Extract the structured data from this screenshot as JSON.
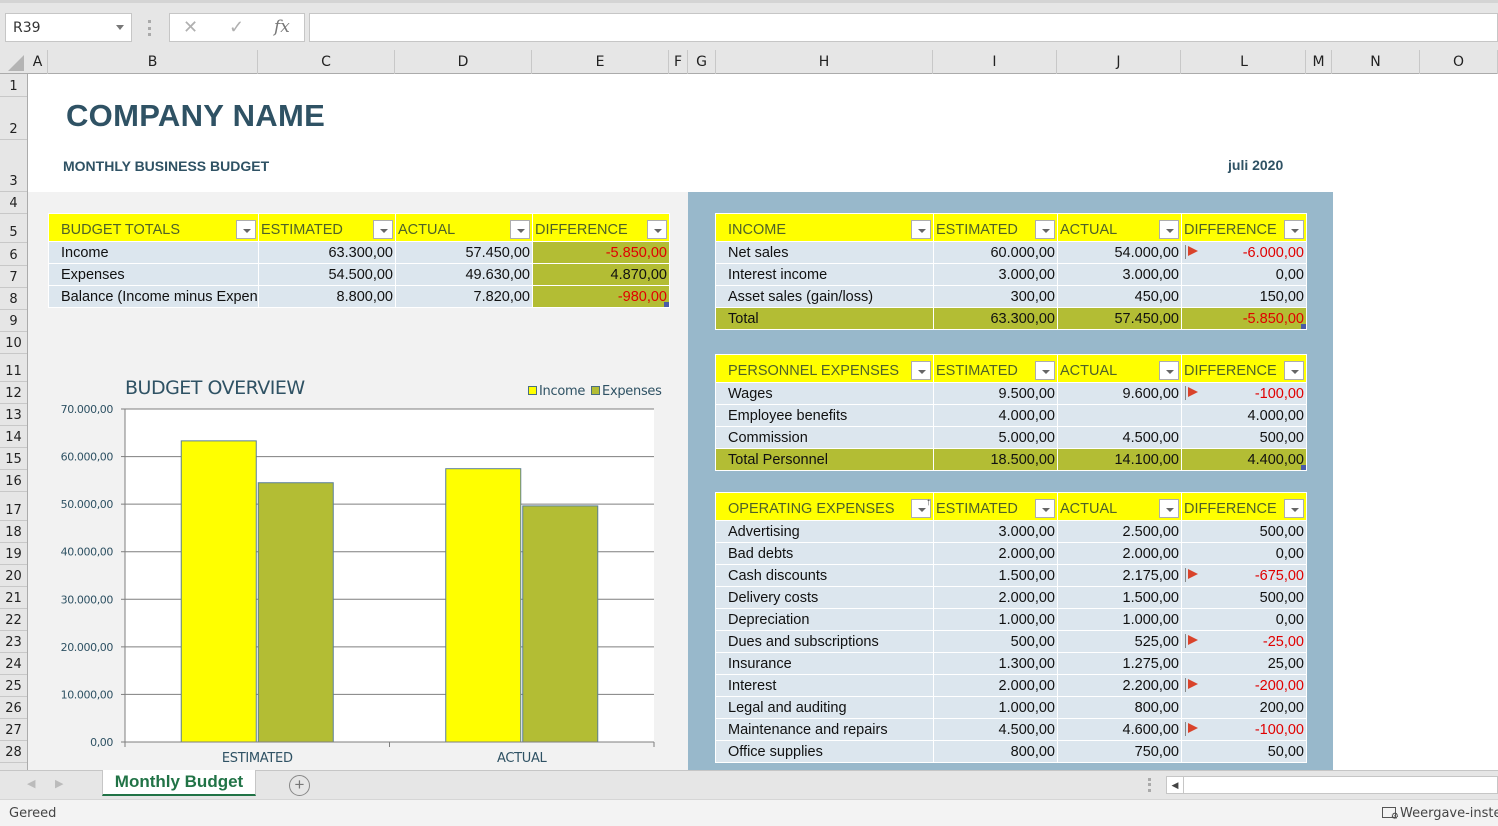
{
  "formula_bar": {
    "name_box": "R39",
    "cancel_icon": "✕",
    "enter_icon": "✓",
    "fx_label": "fx",
    "formula": ""
  },
  "columns": [
    "A",
    "B",
    "C",
    "D",
    "E",
    "F",
    "G",
    "H",
    "I",
    "J",
    "L",
    "M",
    "N",
    "O"
  ],
  "rows": [
    "1",
    "2",
    "3",
    "4",
    "5",
    "6",
    "7",
    "8",
    "9",
    "10",
    "11",
    "12",
    "13",
    "14",
    "15",
    "16",
    "17",
    "18",
    "19",
    "20",
    "21",
    "22",
    "23",
    "24",
    "25",
    "26",
    "27",
    "28"
  ],
  "sheet": {
    "company_name": "COMPANY NAME",
    "subtitle": "MONTHLY BUSINESS BUDGET",
    "month": "juli 2020"
  },
  "budget_totals": {
    "headers": [
      "BUDGET TOTALS",
      "ESTIMATED",
      "ACTUAL",
      "DIFFERENCE"
    ],
    "rows": [
      {
        "label": "Income",
        "estimated": "63.300,00",
        "actual": "57.450,00",
        "difference": "-5.850,00",
        "negative": true
      },
      {
        "label": "Expenses",
        "estimated": "54.500,00",
        "actual": "49.630,00",
        "difference": "4.870,00",
        "negative": false
      },
      {
        "label": "Balance (Income minus Expenses)",
        "estimated": "8.800,00",
        "actual": "7.820,00",
        "difference": "-980,00",
        "negative": true
      }
    ]
  },
  "income": {
    "headers": [
      "INCOME",
      "ESTIMATED",
      "ACTUAL",
      "DIFFERENCE"
    ],
    "rows": [
      {
        "label": "Net sales",
        "estimated": "60.000,00",
        "actual": "54.000,00",
        "difference": "-6.000,00",
        "negative": true,
        "flag": true
      },
      {
        "label": "Interest income",
        "estimated": "3.000,00",
        "actual": "3.000,00",
        "difference": "0,00",
        "negative": false,
        "flag": false
      },
      {
        "label": "Asset sales (gain/loss)",
        "estimated": "300,00",
        "actual": "450,00",
        "difference": "150,00",
        "negative": false,
        "flag": false
      }
    ],
    "total": {
      "label": "Total",
      "estimated": "63.300,00",
      "actual": "57.450,00",
      "difference": "-5.850,00",
      "negative": true
    }
  },
  "personnel": {
    "headers": [
      "PERSONNEL EXPENSES",
      "ESTIMATED",
      "ACTUAL",
      "DIFFERENCE"
    ],
    "rows": [
      {
        "label": "Wages",
        "estimated": "9.500,00",
        "actual": "9.600,00",
        "difference": "-100,00",
        "negative": true,
        "flag": true
      },
      {
        "label": "Employee benefits",
        "estimated": "4.000,00",
        "actual": "",
        "difference": "4.000,00",
        "negative": false,
        "flag": false
      },
      {
        "label": "Commission",
        "estimated": "5.000,00",
        "actual": "4.500,00",
        "difference": "500,00",
        "negative": false,
        "flag": false
      }
    ],
    "total": {
      "label": "Total Personnel",
      "estimated": "18.500,00",
      "actual": "14.100,00",
      "difference": "4.400,00",
      "negative": false
    }
  },
  "operating": {
    "headers": [
      "OPERATING EXPENSES",
      "ESTIMATED",
      "ACTUAL",
      "DIFFERENCE"
    ],
    "rows": [
      {
        "label": "Advertising",
        "estimated": "3.000,00",
        "actual": "2.500,00",
        "difference": "500,00",
        "negative": false,
        "flag": false
      },
      {
        "label": "Bad debts",
        "estimated": "2.000,00",
        "actual": "2.000,00",
        "difference": "0,00",
        "negative": false,
        "flag": false
      },
      {
        "label": "Cash discounts",
        "estimated": "1.500,00",
        "actual": "2.175,00",
        "difference": "-675,00",
        "negative": true,
        "flag": true
      },
      {
        "label": "Delivery costs",
        "estimated": "2.000,00",
        "actual": "1.500,00",
        "difference": "500,00",
        "negative": false,
        "flag": false
      },
      {
        "label": "Depreciation",
        "estimated": "1.000,00",
        "actual": "1.000,00",
        "difference": "0,00",
        "negative": false,
        "flag": false
      },
      {
        "label": "Dues and subscriptions",
        "estimated": "500,00",
        "actual": "525,00",
        "difference": "-25,00",
        "negative": true,
        "flag": true
      },
      {
        "label": "Insurance",
        "estimated": "1.300,00",
        "actual": "1.275,00",
        "difference": "25,00",
        "negative": false,
        "flag": false
      },
      {
        "label": "Interest",
        "estimated": "2.000,00",
        "actual": "2.200,00",
        "difference": "-200,00",
        "negative": true,
        "flag": true
      },
      {
        "label": "Legal and auditing",
        "estimated": "1.000,00",
        "actual": "800,00",
        "difference": "200,00",
        "negative": false,
        "flag": false
      },
      {
        "label": "Maintenance and repairs",
        "estimated": "4.500,00",
        "actual": "4.600,00",
        "difference": "-100,00",
        "negative": true,
        "flag": true
      },
      {
        "label": "Office supplies",
        "estimated": "800,00",
        "actual": "750,00",
        "difference": "50,00",
        "negative": false,
        "flag": false
      }
    ]
  },
  "colors": {
    "income": "#ffff00",
    "expenses": "#b3bd34",
    "header_text": "#2f5264",
    "negative": "#e00000",
    "flag": "#d9432b",
    "panel_blue": "#98b8cb"
  },
  "chart_data": {
    "type": "bar",
    "title": "BUDGET OVERVIEW",
    "categories": [
      "ESTIMATED",
      "ACTUAL"
    ],
    "series": [
      {
        "name": "Income",
        "values": [
          63300,
          57450
        ],
        "color": "#ffff00"
      },
      {
        "name": "Expenses",
        "values": [
          54500,
          49630
        ],
        "color": "#b3bd34"
      }
    ],
    "xlabel": "",
    "ylabel": "",
    "ylim": [
      0,
      70000
    ],
    "yticks": [
      0,
      10000,
      20000,
      30000,
      40000,
      50000,
      60000,
      70000
    ],
    "ytick_labels": [
      "0,00",
      "10.000,00",
      "20.000,00",
      "30.000,00",
      "40.000,00",
      "50.000,00",
      "60.000,00",
      "70.000,00"
    ],
    "grid": true,
    "legend": "top-right"
  },
  "tabs": {
    "sheets": [
      "Monthly Budget"
    ],
    "add_sheet_icon": "+"
  },
  "status": {
    "text": "Gereed",
    "view_settings": "Weergave-instell"
  }
}
